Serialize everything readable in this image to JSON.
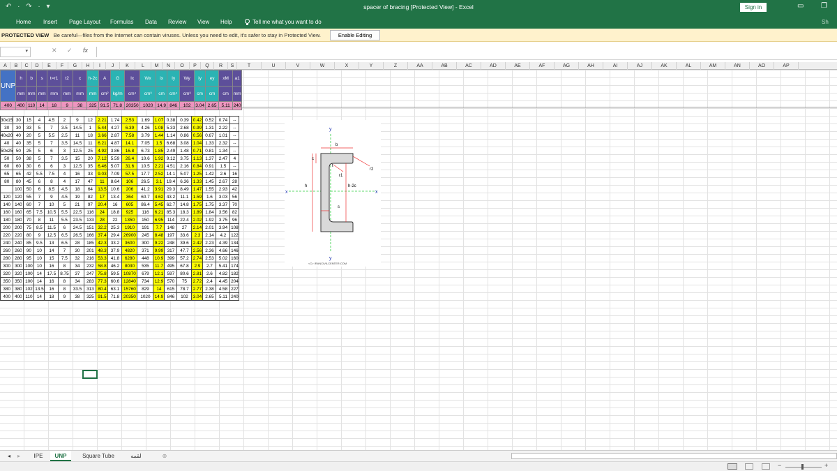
{
  "window": {
    "quick_access": "↶ · ↷ · ▾",
    "title": "spacer of bracing  [Protected View]  -  Excel",
    "sign_in": "Sign in",
    "min": "▭",
    "restore": "❐",
    "share": "Sh"
  },
  "ribbon": {
    "tabs": [
      "Home",
      "Insert",
      "Page Layout",
      "Formulas",
      "Data",
      "Review",
      "View",
      "Help"
    ],
    "tell_me": "Tell me what you want to do"
  },
  "protected": {
    "label": "PROTECTED VIEW",
    "message": "Be careful—files from the Internet can contain viruses. Unless you need to edit, it's safer to stay in Protected View.",
    "button": "Enable Editing"
  },
  "formula_bar": {
    "cancel": "✕",
    "enter": "✓",
    "fx": "fx",
    "name_box": "",
    "content": ""
  },
  "columns": [
    "A",
    "B",
    "C",
    "D",
    "E",
    "F",
    "G",
    "H",
    "I",
    "J",
    "K",
    "L",
    "M",
    "N",
    "O",
    "P",
    "Q",
    "R",
    "S",
    "T",
    "U",
    "V",
    "W",
    "X",
    "Y",
    "Z",
    "AA",
    "AB",
    "AC",
    "AD",
    "AE",
    "AF",
    "AG",
    "AH",
    "AI",
    "AJ",
    "AK",
    "AL",
    "AM",
    "AN",
    "AO",
    "AP"
  ],
  "header": {
    "unp_label": "UNP",
    "symbols": [
      "h",
      "b",
      "s",
      "t=r1",
      "t2",
      "c",
      "h-2c",
      "A",
      "G",
      "Ix",
      "Wx",
      "ix",
      "Iy",
      "Wy",
      "iy",
      "ey",
      "xM",
      "a1"
    ],
    "units": [
      "mm",
      "mm",
      "mm",
      "mm",
      "mm",
      "mm",
      "mm",
      "cm²",
      "kg/m",
      "cm⁴",
      "cm³",
      "cm",
      "cm⁴",
      "cm³",
      "cm",
      "cm",
      "cm",
      "mm"
    ],
    "pink_row": [
      "400",
      "400",
      "110",
      "14",
      "18",
      "9",
      "38",
      "325",
      "91.5",
      "71.8",
      "20350",
      "1020",
      "14.9",
      "846",
      "102",
      "3.04",
      "2.65",
      "5.11",
      "240"
    ]
  },
  "rows": [
    [
      "30x15",
      "30",
      "15",
      "4",
      "4.5",
      "2",
      "9",
      "12",
      "2.21",
      "1.74",
      "2.53",
      "1.69",
      "1.07",
      "0.38",
      "0.39",
      "0.42",
      "0.52",
      "0.74",
      "--"
    ],
    [
      "30",
      "30",
      "33",
      "5",
      "7",
      "3.5",
      "14.5",
      "1",
      "5.44",
      "4.27",
      "6.39",
      "4.26",
      "1.08",
      "5.33",
      "2.68",
      "0.99",
      "1.31",
      "2.22",
      "--"
    ],
    [
      "40x20",
      "40",
      "20",
      "5",
      "5.5",
      "2.5",
      "11",
      "18",
      "3.66",
      "2.87",
      "7.58",
      "3.79",
      "1.44",
      "1.14",
      "0.86",
      "0.56",
      "0.67",
      "1.01",
      "--"
    ],
    [
      "40",
      "40",
      "35",
      "5",
      "7",
      "3.5",
      "14.5",
      "11",
      "6.21",
      "4.87",
      "14.1",
      "7.05",
      "1.5",
      "6.68",
      "3.08",
      "1.04",
      "1.33",
      "2.32",
      "--"
    ],
    [
      "50x25",
      "50",
      "25",
      "5",
      "6",
      "3",
      "12.5",
      "25",
      "4.92",
      "3.86",
      "16.8",
      "6.73",
      "1.85",
      "2.49",
      "1.48",
      "0.71",
      "0.81",
      "1.34",
      "--"
    ],
    [
      "50",
      "50",
      "38",
      "5",
      "7",
      "3.5",
      "15",
      "20",
      "7.12",
      "5.59",
      "26.4",
      "10.6",
      "1.92",
      "9.12",
      "3.75",
      "1.13",
      "1.37",
      "2.47",
      "4"
    ],
    [
      "60",
      "60",
      "30",
      "6",
      "6",
      "3",
      "12.5",
      "35",
      "6.46",
      "5.07",
      "31.6",
      "10.5",
      "2.21",
      "4.51",
      "2.16",
      "0.84",
      "0.91",
      "1.5",
      "--"
    ],
    [
      "65",
      "65",
      "42",
      "5.5",
      "7.5",
      "4",
      "16",
      "33",
      "9.03",
      "7.09",
      "57.5",
      "17.7",
      "2.52",
      "14.1",
      "5.07",
      "1.25",
      "1.42",
      "2.6",
      "16"
    ],
    [
      "80",
      "80",
      "45",
      "6",
      "8",
      "4",
      "17",
      "47",
      "11",
      "8.64",
      "106",
      "26.5",
      "3.1",
      "19.4",
      "6.36",
      "1.33",
      "1.45",
      "2.67",
      "28"
    ],
    [
      "",
      "100",
      "50",
      "6",
      "8.5",
      "4.5",
      "18",
      "64",
      "13.5",
      "10.6",
      "206",
      "41.2",
      "3.91",
      "29.3",
      "8.49",
      "1.47",
      "1.55",
      "2.93",
      "42"
    ],
    [
      "120",
      "120",
      "55",
      "7",
      "9",
      "4.5",
      "19",
      "82",
      "17",
      "13.4",
      "364",
      "60.7",
      "4.62",
      "43.2",
      "11.1",
      "1.59",
      "1.6",
      "3.03",
      "56"
    ],
    [
      "140",
      "140",
      "60",
      "7",
      "10",
      "5",
      "21",
      "97",
      "20.4",
      "16",
      "605",
      "86.4",
      "5.45",
      "62.7",
      "14.8",
      "1.75",
      "1.75",
      "3.37",
      "70"
    ],
    [
      "160",
      "160",
      "65",
      "7.5",
      "10.5",
      "5.5",
      "22.5",
      "116",
      "24",
      "18.8",
      "925",
      "116",
      "6.21",
      "85.3",
      "18.3",
      "1.89",
      "1.84",
      "3.56",
      "82"
    ],
    [
      "180",
      "180",
      "70",
      "8",
      "11",
      "5.5",
      "23.5",
      "133",
      "28",
      "22",
      "1350",
      "150",
      "6.95",
      "114",
      "22.4",
      "2.02",
      "1.92",
      "3.75",
      "96"
    ],
    [
      "200",
      "200",
      "75",
      "8.5",
      "11.5",
      "6",
      "24.5",
      "151",
      "32.2",
      "25.3",
      "1910",
      "191",
      "7.7",
      "148",
      "27",
      "2.14",
      "2.01",
      "3.94",
      "108"
    ],
    [
      "220",
      "220",
      "80",
      "9",
      "12.5",
      "6.5",
      "26.5",
      "166",
      "37.4",
      "29.4",
      "26900",
      "245",
      "8.48",
      "197",
      "33.6",
      "2.3",
      "2.14",
      "4.2",
      "122"
    ],
    [
      "240",
      "240",
      "85",
      "9.5",
      "13",
      "6.5",
      "28",
      "185",
      "42.3",
      "33.2",
      "3600",
      "300",
      "9.22",
      "248",
      "39.6",
      "2.42",
      "2.23",
      "4.39",
      "134"
    ],
    [
      "260",
      "260",
      "90",
      "10",
      "14",
      "7",
      "30",
      "201",
      "48.3",
      "37.9",
      "4820",
      "371",
      "9.99",
      "317",
      "47.7",
      "2.56",
      "2.36",
      "4.66",
      "146"
    ],
    [
      "280",
      "280",
      "95",
      "10",
      "15",
      "7.5",
      "32",
      "216",
      "53.3",
      "41.8",
      "6280",
      "448",
      "10.9",
      "399",
      "57.2",
      "2.74",
      "2.53",
      "5.02",
      "160"
    ],
    [
      "300",
      "300",
      "100",
      "10",
      "16",
      "8",
      "34",
      "232",
      "58.8",
      "46.2",
      "8030",
      "535",
      "11.7",
      "495",
      "67.8",
      "2.9",
      "2.7",
      "5.41",
      "174"
    ],
    [
      "320",
      "320",
      "100",
      "14",
      "17.5",
      "8.75",
      "37",
      "247",
      "75.8",
      "59.5",
      "10870",
      "679",
      "12.1",
      "597",
      "80.6",
      "2.81",
      "2.6",
      "4.82",
      "182"
    ],
    [
      "350",
      "350",
      "100",
      "14",
      "16",
      "8",
      "34",
      "283",
      "77.3",
      "60.6",
      "12840",
      "734",
      "12.9",
      "570",
      "75",
      "2.72",
      "2.4",
      "4.45",
      "204"
    ],
    [
      "380",
      "380",
      "102",
      "13.5",
      "16",
      "8",
      "33.5",
      "313",
      "80.4",
      "63.1",
      "15760",
      "829",
      "14",
      "615",
      "78.7",
      "2.77",
      "2.38",
      "4.58",
      "227"
    ],
    [
      "400",
      "400",
      "110",
      "14",
      "18",
      "9",
      "38",
      "325",
      "91.5",
      "71.8",
      "20350",
      "1020",
      "14.9",
      "846",
      "102",
      "3.04",
      "2.65",
      "5.11",
      "240"
    ]
  ],
  "figure": {
    "labels": {
      "y_top": "y",
      "y_bottom": "y",
      "x_left": "x",
      "x_right": "x",
      "b": "b",
      "c": "c",
      "t": "t",
      "r1": "r1",
      "r2": "r2",
      "h": "h",
      "h2c": "h-2c",
      "s": "s",
      "credit": "<C> IRANCIVILCENTER.COM"
    }
  },
  "sheets": [
    {
      "name": "IPE",
      "active": false
    },
    {
      "name": "UNP",
      "active": true
    },
    {
      "name": "Square Tube",
      "active": false
    },
    {
      "name": "لقمه",
      "active": false
    }
  ],
  "add_sheet": "⊕",
  "nav_prev": "◂",
  "nav_next": "▸",
  "status": {
    "zoom_minus": "−",
    "zoom_plus": "+"
  },
  "colors": {
    "excel_green": "#217346",
    "header_purple": "#5d4f9a",
    "header_teal": "#2bb3b3",
    "pink_row": "#ee95bf",
    "yellow": "#ffff00"
  }
}
